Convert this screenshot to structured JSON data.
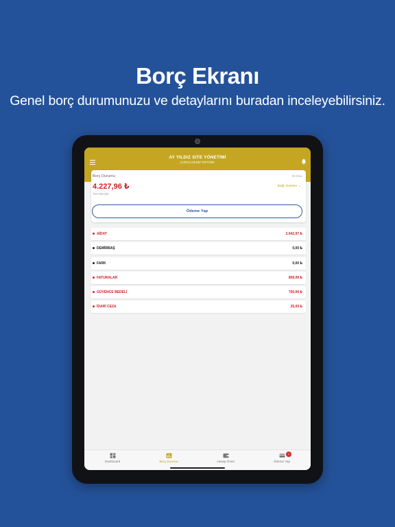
{
  "promo": {
    "title": "Borç Ekranı",
    "subtitle": "Genel borç durumunuzu ve detaylarını buradan inceleyebilirsiniz."
  },
  "header": {
    "title": "AY YILDIZ SITE YÖNETİMİ",
    "subtitle": "(A/001) DENİZ ÖZTÜRK"
  },
  "summary": {
    "label": "Borç Durumu",
    "date": "04 Oca",
    "amount": "4.227,96 ₺",
    "caption": "Tüm Borçlar",
    "link": "Bağlı Daireler ⌄",
    "pay_button": "Ödeme Yap"
  },
  "debts": [
    {
      "name": "AİDAT",
      "amount": "2.642,97 ₺",
      "color": "#cf2127"
    },
    {
      "name": "DEMİRBAŞ",
      "amount": "0,00 ₺",
      "color": "#1a1a1a"
    },
    {
      "name": "FARK",
      "amount": "0,00 ₺",
      "color": "#1a1a1a"
    },
    {
      "name": "FATURALAR",
      "amount": "809,99 ₺",
      "color": "#cf2127"
    },
    {
      "name": "GÜVENCE BEDELİ",
      "amount": "750,00 ₺",
      "color": "#cf2127"
    },
    {
      "name": "İDARİ CEZA",
      "amount": "25,00 ₺",
      "color": "#cf2127"
    }
  ],
  "nav": [
    {
      "label": "Dashboard",
      "icon": "dashboard-icon",
      "active": false
    },
    {
      "label": "Borç Durumu",
      "icon": "debt-status-icon",
      "active": true
    },
    {
      "label": "Hesap Özeti",
      "icon": "wallet-icon",
      "active": false
    },
    {
      "label": "Ödeme Yap",
      "icon": "payment-icon",
      "active": false,
      "badge": "1"
    }
  ],
  "colors": {
    "background": "#24529a",
    "header": "#c4a623",
    "debt_red": "#cf2127",
    "accent_blue": "#2d5aa0"
  }
}
